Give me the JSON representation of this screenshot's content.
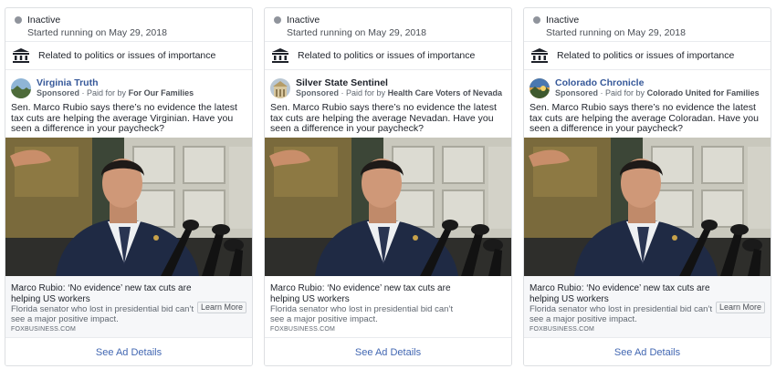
{
  "colors": {
    "accent": "#365899",
    "link": "#4267b2",
    "status_dot": "#90949c",
    "border": "#dddfe2"
  },
  "cards": [
    {
      "status": "Inactive",
      "started": "Started running on May 29, 2018",
      "category": "Related to politics or issues of importance",
      "page_name": "Virginia Truth",
      "sponsored": "Sponsored",
      "paid_for_prefix": "· Paid for by",
      "payer": "For Our Families",
      "body": "Sen. Marco Rubio says there’s no evidence the latest tax cuts are helping the average Virginian. Have you seen a difference in your paycheck?",
      "link_title": "Marco Rubio: ‘No evidence’ new tax cuts are helping US workers",
      "link_description": "Florida senator who lost in presidential bid can’t see a major positive impact.",
      "link_domain": "FOXBUSINESS.COM",
      "cta": "Learn More",
      "details": "See Ad Details",
      "avatar_icon": "landscape-photo-icon"
    },
    {
      "status": "Inactive",
      "started": "Started running on May 29, 2018",
      "category": "Related to politics or issues of importance",
      "page_name": "Silver State Sentinel",
      "sponsored": "Sponsored",
      "paid_for_prefix": "· Paid for by",
      "payer": "Health Care Voters of Nevada",
      "body": "Sen. Marco Rubio says there’s no evidence the latest tax cuts are helping the average Nevadan. Have you seen a difference in your paycheck?",
      "link_title": "Marco Rubio: ‘No evidence’ new tax cuts are helping US workers",
      "link_description": "Florida senator who lost in presidential bid can’t see a major positive impact.",
      "link_domain": "FOXBUSINESS.COM",
      "cta": "Learn More",
      "details": "See Ad Details",
      "avatar_icon": "landmark-photo-icon"
    },
    {
      "status": "Inactive",
      "started": "Started running on May 29, 2018",
      "category": "Related to politics or issues of importance",
      "page_name": "Colorado Chronicle",
      "sponsored": "Sponsored",
      "paid_for_prefix": "· Paid for by",
      "payer": "Colorado United for Families",
      "body": "Sen. Marco Rubio says there’s no evidence the latest tax cuts are helping the average Coloradan. Have you seen a difference in your paycheck?",
      "link_title": "Marco Rubio: ‘No evidence’ new tax cuts are helping US workers",
      "link_description": "Florida senator who lost in presidential bid can’t see a major positive impact.",
      "link_domain": "FOXBUSINESS.COM",
      "cta": "Learn More",
      "details": "See Ad Details",
      "avatar_icon": "sunset-photo-icon"
    }
  ]
}
